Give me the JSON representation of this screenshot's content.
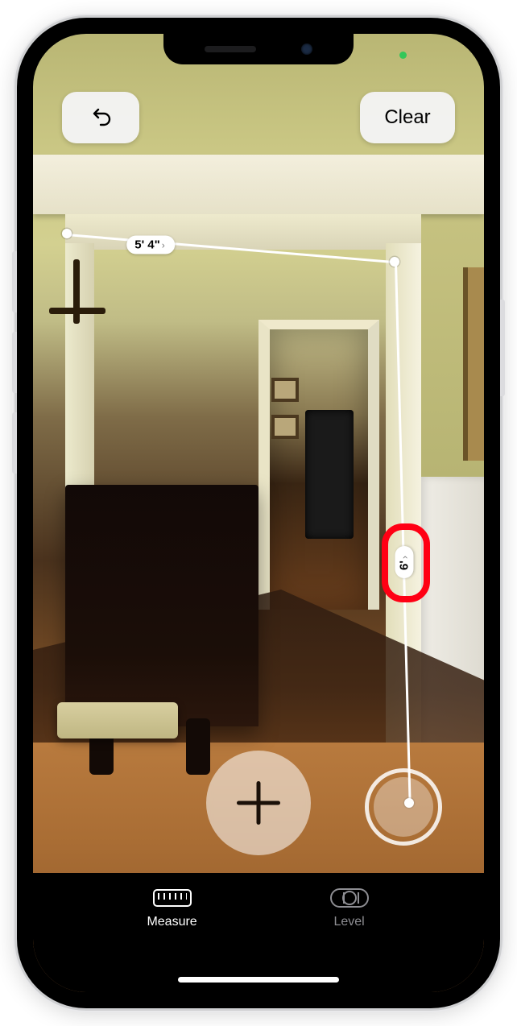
{
  "status": {
    "privacy_indicator": "camera-active"
  },
  "topbar": {
    "undo_label": "Undo",
    "clear_label": "Clear"
  },
  "measurements": {
    "width": {
      "value": "5' 4\"",
      "expandable": true
    },
    "height": {
      "value": "6'",
      "expandable": true
    }
  },
  "actions": {
    "add_point_label": "Add Point",
    "capture_label": "Capture"
  },
  "tabs": {
    "measure_label": "Measure",
    "level_label": "Level",
    "active": "measure"
  },
  "annotation": {
    "highlighted_measurement": "height"
  }
}
